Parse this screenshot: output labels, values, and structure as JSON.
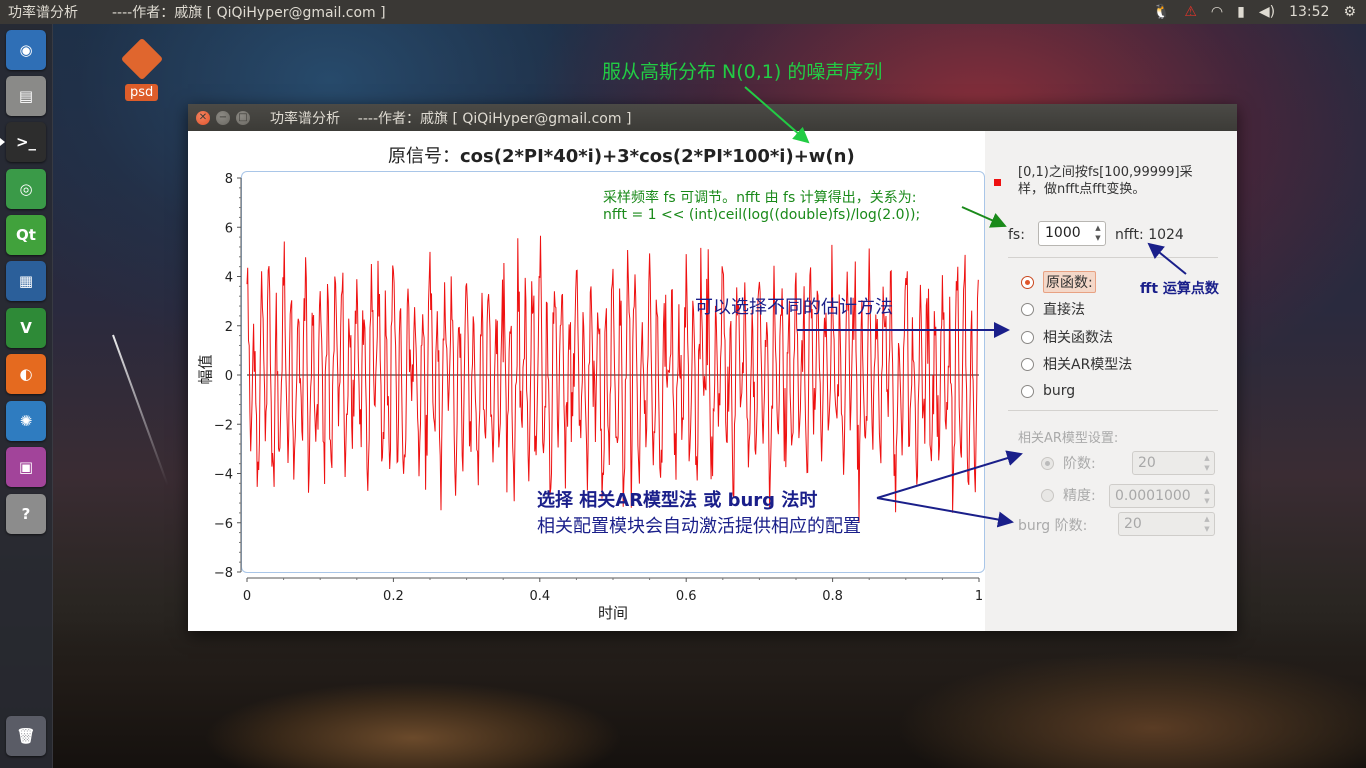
{
  "top_panel": {
    "app_name": "功率谱分析",
    "window_title": "----作者：戚旗 [ QiQiHyper@gmail.com ]",
    "clock": "13:52"
  },
  "launcher": {
    "items": [
      {
        "name": "ubuntu-dash-icon",
        "glyph": "◉",
        "color": "#2f6fb6"
      },
      {
        "name": "file-manager-icon",
        "glyph": "▤",
        "color": "#8a8a88"
      },
      {
        "name": "terminal-icon",
        "glyph": ">_",
        "color": "#2d2d2d"
      },
      {
        "name": "chrome-icon",
        "glyph": "◎",
        "color": "#3a9a48"
      },
      {
        "name": "qt-creator-icon",
        "glyph": "Qt",
        "color": "#41a23c"
      },
      {
        "name": "virtualbox-icon",
        "glyph": "▦",
        "color": "#2b5f9a"
      },
      {
        "name": "vim-icon",
        "glyph": "V",
        "color": "#2e8a37"
      },
      {
        "name": "firefox-icon",
        "glyph": "◐",
        "color": "#e56a1f"
      },
      {
        "name": "shotwell-icon",
        "glyph": "✺",
        "color": "#2f7cc0"
      },
      {
        "name": "video-app-icon",
        "glyph": "▣",
        "color": "#a2449a"
      },
      {
        "name": "unknown-app-icon",
        "glyph": "?",
        "color": "#8c8c8c"
      },
      {
        "name": "trash-icon",
        "glyph": "🗑",
        "color": "#5a5c66"
      }
    ]
  },
  "desktop": {
    "icon_label": "psd"
  },
  "window": {
    "title": "功率谱分析    ----作者：戚旗 [ QiQiHyper@gmail.com ]",
    "close_glyph": "✕",
    "min_glyph": "−",
    "max_glyph": "□"
  },
  "plot": {
    "title_prefix": "原信号：",
    "title_formula": "cos(2*PI*40*i)+3*cos(2*PI*100*i)+w(n)",
    "xlabel": "时间",
    "ylabel": "幅值"
  },
  "chart_data": {
    "type": "line",
    "title": "原信号：cos(2*PI*40*i)+3*cos(2*PI*100*i)+w(n)",
    "xlabel": "时间",
    "ylabel": "幅值",
    "xlim": [
      0,
      1
    ],
    "ylim": [
      -8,
      8
    ],
    "x_ticks": [
      "0",
      "0.2",
      "0.4",
      "0.6",
      "0.8",
      "1"
    ],
    "y_ticks": [
      "8",
      "6",
      "4",
      "2",
      "0",
      "−2",
      "−4",
      "−6",
      "−8"
    ],
    "grid": false,
    "series": [
      {
        "color": "#ee1111",
        "description_samples": 1000,
        "formula": "cos(2*PI*40*i)+3*cos(2*PI*100*i)+w(n)"
      }
    ]
  },
  "panel": {
    "info": "[0,1)之间按fs[100,99999]采样，做nfft点fft变换。",
    "fs_label": "fs:",
    "fs_value": "1000",
    "nfft_label": "nfft:",
    "nfft_value": "1024",
    "methods": [
      "原函数:",
      "直接法",
      "相关函数法",
      "相关AR模型法",
      "burg"
    ],
    "selected_method_index": 0,
    "ar_group_title": "相关AR模型设置:",
    "order_label": "阶数:",
    "order_value": "20",
    "precision_label": "精度:",
    "precision_value": "0.0001000",
    "burg_order_label": "burg 阶数:",
    "burg_order_value": "20"
  },
  "annotations": {
    "noise": "服从高斯分布 N(0,1) 的噪声序列",
    "fs_note_1": "采样频率 fs 可调节。nfft 由 fs 计算得出，关系为:",
    "fs_note_2": "nfft =  1 << (int)ceil(log((double)fs)/log(2.0));",
    "fft_points": "fft 运算点数",
    "methods": "可以选择不同的估计方法",
    "config_1": "选择 相关AR模型法 或 burg 法时",
    "config_2": "相关配置模块会自动激活提供相应的配置",
    "colors": {
      "green": "#22cc44",
      "dark_green": "#1a8a1a",
      "navy": "#1a1f8a"
    }
  }
}
